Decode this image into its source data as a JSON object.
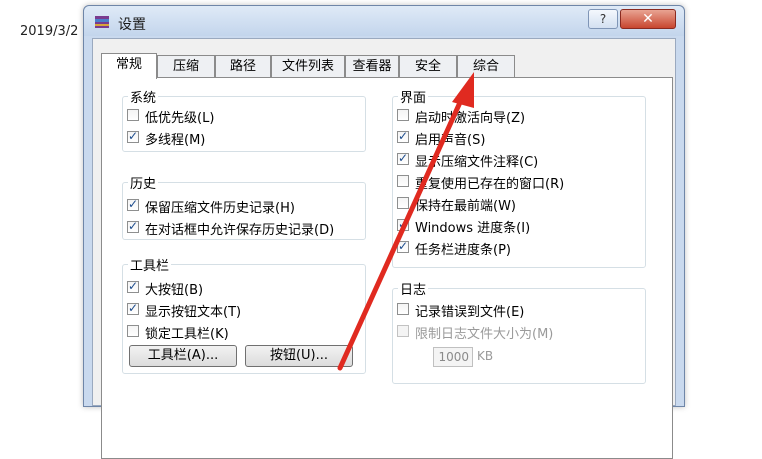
{
  "background_date": "2019/3/2",
  "window": {
    "title": "设置",
    "help_label": "?",
    "close_label": "✕"
  },
  "tabs": [
    {
      "label": "常规",
      "active": true
    },
    {
      "label": "压缩"
    },
    {
      "label": "路径"
    },
    {
      "label": "文件列表"
    },
    {
      "label": "查看器"
    },
    {
      "label": "安全"
    },
    {
      "label": "综合"
    }
  ],
  "system": {
    "title": "系统",
    "items": [
      {
        "label": "低优先级(L)",
        "checked": false
      },
      {
        "label": "多线程(M)",
        "checked": true
      }
    ]
  },
  "history": {
    "title": "历史",
    "items": [
      {
        "label": "保留压缩文件历史记录(H)",
        "checked": true
      },
      {
        "label": "在对话框中允许保存历史记录(D)",
        "checked": true
      }
    ]
  },
  "toolbar": {
    "title": "工具栏",
    "items": [
      {
        "label": "大按钮(B)",
        "checked": true
      },
      {
        "label": "显示按钮文本(T)",
        "checked": true
      },
      {
        "label": "锁定工具栏(K)",
        "checked": false
      }
    ],
    "toolbar_button": "工具栏(A)...",
    "buttons_button": "按钮(U)..."
  },
  "interface": {
    "title": "界面",
    "items": [
      {
        "label": "启动时激活向导(Z)",
        "checked": false
      },
      {
        "label": "启用声音(S)",
        "checked": true
      },
      {
        "label": "显示压缩文件注释(C)",
        "checked": true
      },
      {
        "label": "重复使用已存在的窗口(R)",
        "checked": false
      },
      {
        "label": "保持在最前端(W)",
        "checked": false
      },
      {
        "label": "Windows 进度条(I)",
        "checked": true
      },
      {
        "label": "任务栏进度条(P)",
        "checked": true
      }
    ]
  },
  "log": {
    "title": "日志",
    "items": [
      {
        "label": "记录错误到文件(E)",
        "checked": false
      },
      {
        "label": "限制日志文件大小为(M)",
        "checked": false,
        "disabled": true
      }
    ],
    "size_value": "1000",
    "size_unit": "KB"
  },
  "colors": {
    "arrow": "#e02a20",
    "title_bg": "#c9d9ee",
    "close_btn": "#c8462f"
  }
}
